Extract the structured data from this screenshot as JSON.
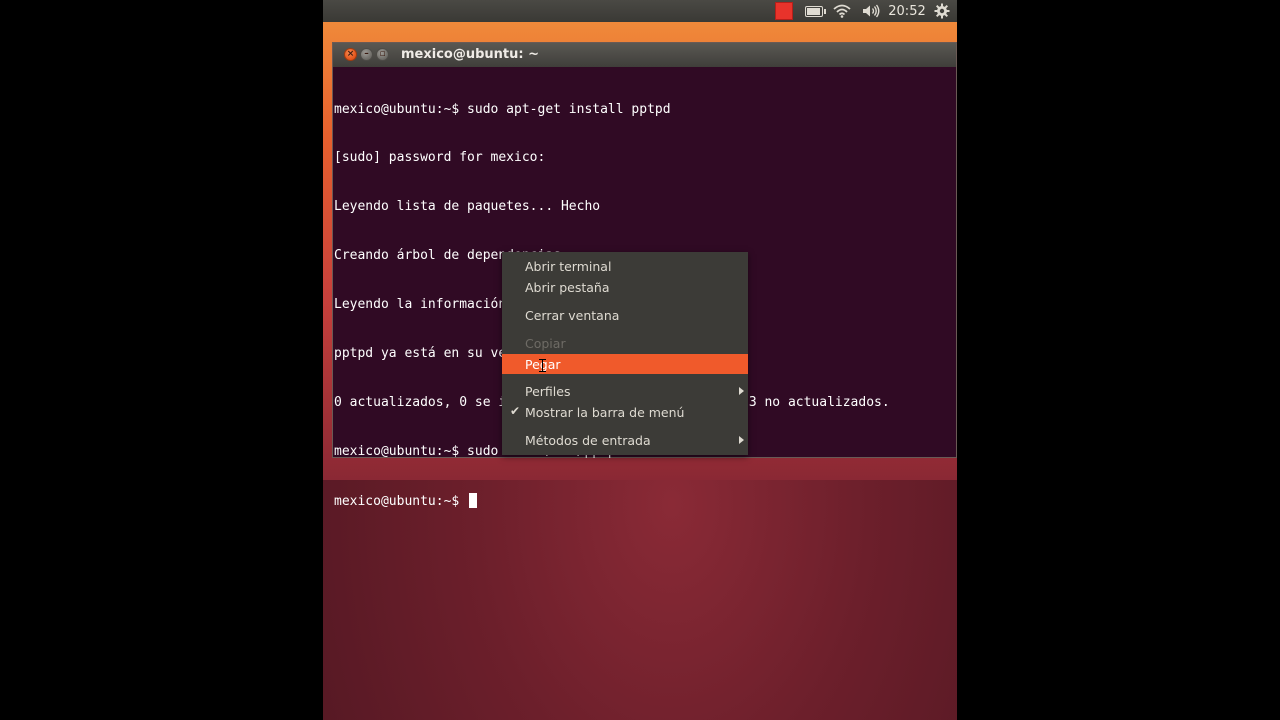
{
  "panel": {
    "clock": "20:52",
    "icons": [
      "indicator-red-square",
      "battery-icon",
      "wifi-icon",
      "volume-icon",
      "gear-icon"
    ]
  },
  "terminal": {
    "title": "mexico@ubuntu: ~",
    "lines": [
      "mexico@ubuntu:~$ sudo apt-get install pptpd",
      "[sudo] password for mexico:",
      "Leyendo lista de paquetes... Hecho",
      "Creando árbol de dependencias",
      "Leyendo la información de estado... Hecho",
      "pptpd ya está en su versión más reciente.",
      "0 actualizados, 0 se instalarán, 0 para eliminar y 303 no actualizados.",
      "mexico@ubuntu:~$ sudo nano /etc/pptpd.conf",
      "mexico@ubuntu:~$ "
    ]
  },
  "context_menu": {
    "items": [
      {
        "label": "Abrir terminal",
        "enabled": true
      },
      {
        "label": "Abrir pestaña",
        "enabled": true
      },
      {
        "label": "Cerrar ventana",
        "enabled": true
      },
      {
        "label": "Copiar",
        "enabled": false
      },
      {
        "label": "Pegar",
        "enabled": true,
        "highlighted": true
      },
      {
        "label": "Perfiles",
        "enabled": true,
        "submenu": true
      },
      {
        "label": "Mostrar la barra de menú",
        "enabled": true,
        "checked": true
      },
      {
        "label": "Métodos de entrada",
        "enabled": true,
        "submenu": true
      }
    ]
  },
  "colors": {
    "terminal_bg": "#300a24",
    "menu_highlight": "#f05a2b",
    "menu_bg": "#3c3b37"
  }
}
